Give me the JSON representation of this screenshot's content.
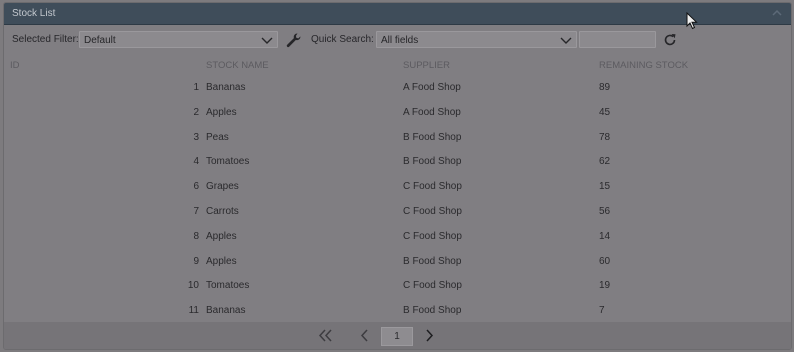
{
  "window": {
    "title": "Stock List"
  },
  "toolbar": {
    "filter_label": "Selected Filter:",
    "filter_value": "Default",
    "search_label": "Quick Search:",
    "search_field_value": "All fields",
    "search_input_value": ""
  },
  "table": {
    "columns": [
      "ID",
      "STOCK NAME",
      "SUPPLIER",
      "REMAINING STOCK"
    ],
    "rows": [
      {
        "id": "1",
        "name": "Bananas",
        "supplier": "A Food Shop",
        "remaining": "89"
      },
      {
        "id": "2",
        "name": "Apples",
        "supplier": "A Food Shop",
        "remaining": "45"
      },
      {
        "id": "3",
        "name": "Peas",
        "supplier": "B Food Shop",
        "remaining": "78"
      },
      {
        "id": "4",
        "name": "Tomatoes",
        "supplier": "B Food Shop",
        "remaining": "62"
      },
      {
        "id": "6",
        "name": "Grapes",
        "supplier": "C Food Shop",
        "remaining": "15"
      },
      {
        "id": "7",
        "name": "Carrots",
        "supplier": "C Food Shop",
        "remaining": "56"
      },
      {
        "id": "8",
        "name": "Apples",
        "supplier": "C Food Shop",
        "remaining": "14"
      },
      {
        "id": "9",
        "name": "Apples",
        "supplier": "B Food Shop",
        "remaining": "60"
      },
      {
        "id": "10",
        "name": "Tomatoes",
        "supplier": "C Food Shop",
        "remaining": "19"
      },
      {
        "id": "11",
        "name": "Bananas",
        "supplier": "B Food Shop",
        "remaining": "7"
      }
    ]
  },
  "pager": {
    "current_page": "1"
  },
  "icons": {
    "collapse": "chevron-up-icon",
    "filter_dropdown": "chevron-down-icon",
    "settings": "wrench-icon",
    "refresh": "refresh-icon",
    "first": "double-chevron-left-icon",
    "prev": "chevron-left-icon",
    "next": "chevron-right-icon"
  },
  "colors": {
    "titlebar": "#3f4d5a",
    "overlay_tint": "#807e82"
  }
}
